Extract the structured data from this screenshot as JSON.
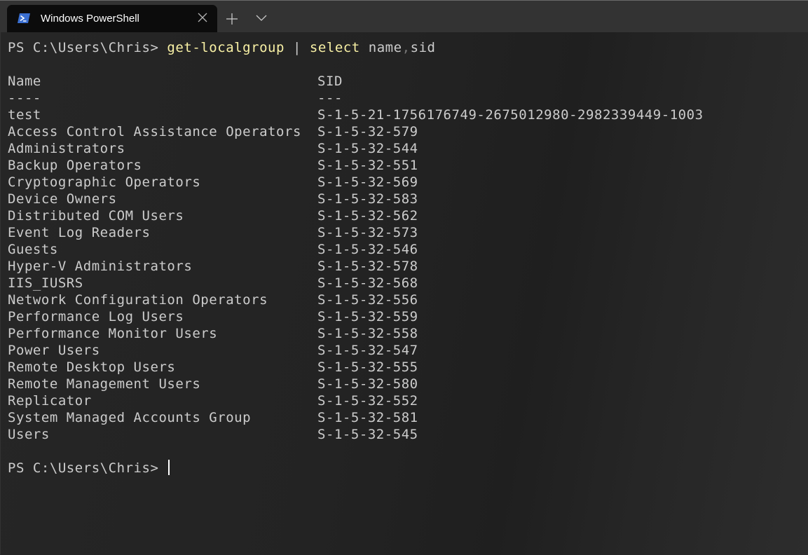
{
  "window": {
    "tab_title": "Windows PowerShell",
    "tab_icon": "powershell-icon",
    "close_icon": "close-icon",
    "new_tab_icon": "plus-icon",
    "dropdown_icon": "chevron-down-icon",
    "accent_color": "#3a6fd1"
  },
  "terminal": {
    "prompt": "PS C:\\Users\\Chris> ",
    "command": {
      "cmd": "get-localgroup",
      "pipe": " | ",
      "select": "select",
      "args_a": " name",
      "comma": ",",
      "args_b": "sid"
    },
    "table": {
      "headers": [
        "Name",
        "SID"
      ],
      "underlines": [
        "----",
        "---"
      ],
      "rows": [
        {
          "name": "test",
          "sid": "S-1-5-21-1756176749-2675012980-2982339449-1003"
        },
        {
          "name": "Access Control Assistance Operators",
          "sid": "S-1-5-32-579"
        },
        {
          "name": "Administrators",
          "sid": "S-1-5-32-544"
        },
        {
          "name": "Backup Operators",
          "sid": "S-1-5-32-551"
        },
        {
          "name": "Cryptographic Operators",
          "sid": "S-1-5-32-569"
        },
        {
          "name": "Device Owners",
          "sid": "S-1-5-32-583"
        },
        {
          "name": "Distributed COM Users",
          "sid": "S-1-5-32-562"
        },
        {
          "name": "Event Log Readers",
          "sid": "S-1-5-32-573"
        },
        {
          "name": "Guests",
          "sid": "S-1-5-32-546"
        },
        {
          "name": "Hyper-V Administrators",
          "sid": "S-1-5-32-578"
        },
        {
          "name": "IIS_IUSRS",
          "sid": "S-1-5-32-568"
        },
        {
          "name": "Network Configuration Operators",
          "sid": "S-1-5-32-556"
        },
        {
          "name": "Performance Log Users",
          "sid": "S-1-5-32-559"
        },
        {
          "name": "Performance Monitor Users",
          "sid": "S-1-5-32-558"
        },
        {
          "name": "Power Users",
          "sid": "S-1-5-32-547"
        },
        {
          "name": "Remote Desktop Users",
          "sid": "S-1-5-32-555"
        },
        {
          "name": "Remote Management Users",
          "sid": "S-1-5-32-580"
        },
        {
          "name": "Replicator",
          "sid": "S-1-5-32-552"
        },
        {
          "name": "System Managed Accounts Group",
          "sid": "S-1-5-32-581"
        },
        {
          "name": "Users",
          "sid": "S-1-5-32-545"
        }
      ]
    },
    "final_prompt": "PS C:\\Users\\Chris> "
  }
}
